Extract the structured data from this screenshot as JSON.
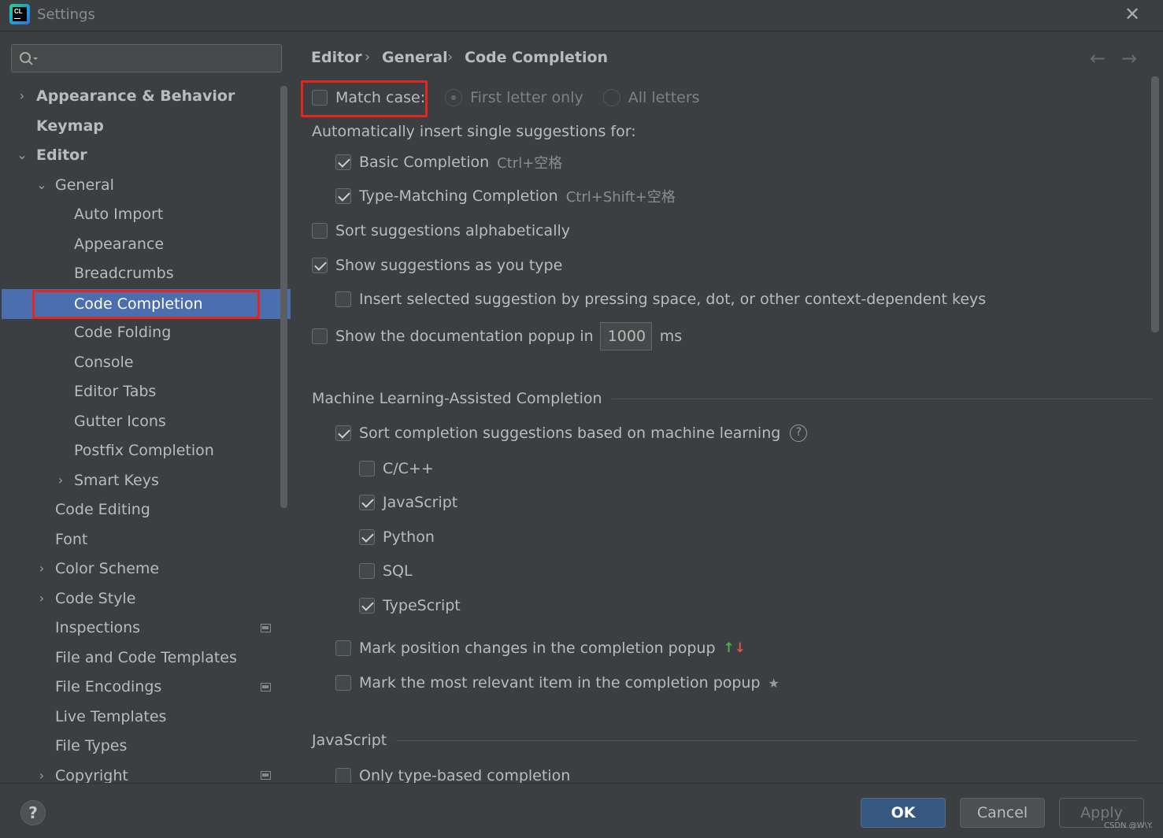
{
  "window": {
    "title": "Settings",
    "close_glyph": "✕"
  },
  "search": {
    "placeholder": ""
  },
  "tree": {
    "appearance_behavior": "Appearance & Behavior",
    "keymap": "Keymap",
    "editor": "Editor",
    "general": "General",
    "auto_import": "Auto Import",
    "appearance": "Appearance",
    "breadcrumbs": "Breadcrumbs",
    "code_completion": "Code Completion",
    "code_folding": "Code Folding",
    "console": "Console",
    "editor_tabs": "Editor Tabs",
    "gutter_icons": "Gutter Icons",
    "postfix_completion": "Postfix Completion",
    "smart_keys": "Smart Keys",
    "code_editing": "Code Editing",
    "font": "Font",
    "color_scheme": "Color Scheme",
    "code_style": "Code Style",
    "inspections": "Inspections",
    "file_code_templates": "File and Code Templates",
    "file_encodings": "File Encodings",
    "live_templates": "Live Templates",
    "file_types": "File Types",
    "copyright": "Copyright"
  },
  "breadcrumb": {
    "editor": "Editor",
    "general": "General",
    "page": "Code Completion",
    "sep": "›"
  },
  "nav": {
    "back": "←",
    "forward": "→"
  },
  "settings": {
    "match_case": {
      "label": "Match case:",
      "checked": false
    },
    "first_letter_only": "First letter only",
    "all_letters": "All letters",
    "auto_insert_heading": "Automatically insert single suggestions for:",
    "basic_completion": {
      "label": "Basic Completion",
      "shortcut": "Ctrl+空格",
      "checked": true
    },
    "type_matching": {
      "label": "Type-Matching Completion",
      "shortcut": "Ctrl+Shift+空格",
      "checked": true
    },
    "sort_alpha": {
      "label": "Sort suggestions alphabetically",
      "checked": false
    },
    "show_as_type": {
      "label": "Show suggestions as you type",
      "checked": true
    },
    "insert_selected": {
      "label": "Insert selected suggestion by pressing space, dot, or other context-dependent keys",
      "checked": false
    },
    "doc_popup": {
      "label": "Show the documentation popup in",
      "value": "1000",
      "unit": "ms",
      "checked": false
    },
    "ml_section": "Machine Learning-Assisted Completion",
    "ml_sort": {
      "label": "Sort completion suggestions based on machine learning",
      "checked": true
    },
    "ml_cpp": {
      "label": "C/C++",
      "checked": false
    },
    "ml_js": {
      "label": "JavaScript",
      "checked": true
    },
    "ml_python": {
      "label": "Python",
      "checked": true
    },
    "ml_sql": {
      "label": "SQL",
      "checked": false
    },
    "ml_ts": {
      "label": "TypeScript",
      "checked": true
    },
    "mark_position": {
      "label": "Mark position changes in the completion popup",
      "checked": false
    },
    "mark_relevant": {
      "label": "Mark the most relevant item in the completion popup",
      "checked": false
    },
    "js_section": "JavaScript",
    "only_type_based": {
      "label": "Only type-based completion",
      "checked": false
    }
  },
  "footer": {
    "help": "?",
    "ok": "OK",
    "cancel": "Cancel",
    "apply": "Apply"
  },
  "watermark": "CSDN @W\\Y.",
  "icons": {
    "arrow_up": "↑",
    "arrow_down": "↓",
    "star": "★",
    "help_circle": "?"
  },
  "colors": {
    "selection": "#4b6eaf",
    "highlight": "#e5251e",
    "ok_button": "#365880"
  }
}
